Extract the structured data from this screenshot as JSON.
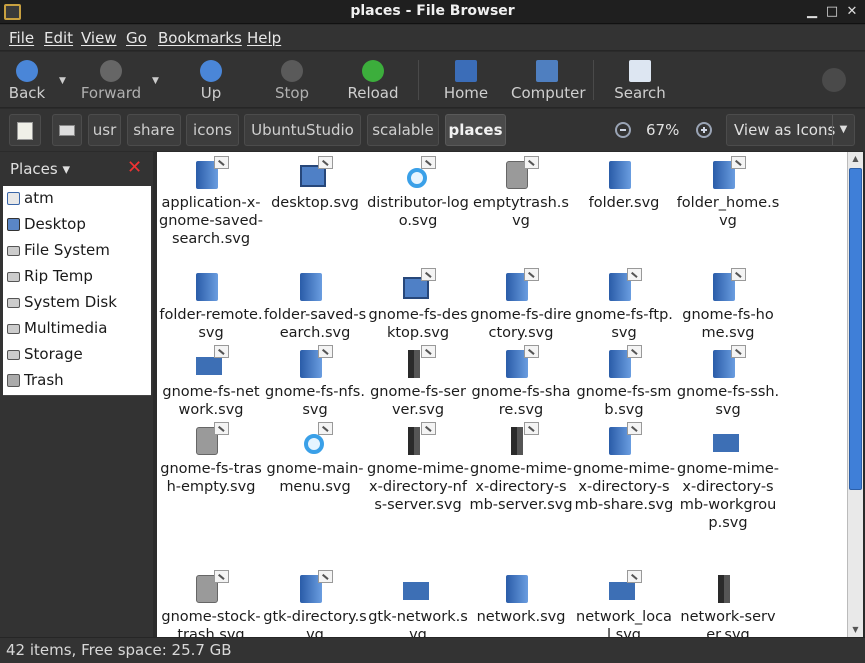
{
  "window": {
    "title": "places - File Browser"
  },
  "menubar": {
    "items": [
      "File",
      "Edit",
      "View",
      "Go",
      "Bookmarks",
      "Help"
    ]
  },
  "toolbar": {
    "buttons": [
      {
        "label": "Back",
        "icon": "back-arrow-icon"
      },
      {
        "label": "Forward",
        "icon": "forward-arrow-icon"
      },
      {
        "label": "Up",
        "icon": "up-arrow-icon"
      },
      {
        "label": "Stop",
        "icon": "stop-icon"
      },
      {
        "label": "Reload",
        "icon": "reload-icon"
      },
      {
        "label": "Home",
        "icon": "home-icon"
      },
      {
        "label": "Computer",
        "icon": "computer-icon"
      },
      {
        "label": "Search",
        "icon": "search-icon"
      }
    ]
  },
  "location": {
    "path": [
      "usr",
      "share",
      "icons",
      "UbuntuStudio",
      "scalable",
      "places"
    ],
    "zoom": "67%",
    "view_mode": "View as Icons"
  },
  "sidebar": {
    "title": "Places",
    "items": [
      "atm",
      "Desktop",
      "File System",
      "Rip Temp",
      "System Disk",
      "Multimedia",
      "Storage",
      "Trash"
    ]
  },
  "files": [
    {
      "name": "application-x-gnome-saved-search.svg",
      "icon": "saved-search-folder-icon"
    },
    {
      "name": "desktop.svg",
      "icon": "desktop-icon"
    },
    {
      "name": "distributor-logo.svg",
      "icon": "distributor-logo-icon"
    },
    {
      "name": "emptytrash.svg",
      "icon": "trash-icon"
    },
    {
      "name": "folder.svg",
      "icon": "folder-icon"
    },
    {
      "name": "folder_home.svg",
      "icon": "home-folder-icon"
    },
    {
      "name": "folder-remote.svg",
      "icon": "folder-icon"
    },
    {
      "name": "folder-saved-search.svg",
      "icon": "saved-search-folder-icon"
    },
    {
      "name": "gnome-fs-desktop.svg",
      "icon": "desktop-icon"
    },
    {
      "name": "gnome-fs-directory.svg",
      "icon": "folder-icon"
    },
    {
      "name": "gnome-fs-ftp.svg",
      "icon": "folder-icon"
    },
    {
      "name": "gnome-fs-home.svg",
      "icon": "home-folder-icon"
    },
    {
      "name": "gnome-fs-network.svg",
      "icon": "network-icon"
    },
    {
      "name": "gnome-fs-nfs.svg",
      "icon": "folder-icon"
    },
    {
      "name": "gnome-fs-server.svg",
      "icon": "server-icon"
    },
    {
      "name": "gnome-fs-share.svg",
      "icon": "folder-icon"
    },
    {
      "name": "gnome-fs-smb.svg",
      "icon": "folder-icon"
    },
    {
      "name": "gnome-fs-ssh.svg",
      "icon": "folder-icon"
    },
    {
      "name": "gnome-fs-trash-empty.svg",
      "icon": "trash-icon"
    },
    {
      "name": "gnome-main-menu.svg",
      "icon": "distributor-logo-icon"
    },
    {
      "name": "gnome-mime-x-directory-nfs-server.svg",
      "icon": "server-icon"
    },
    {
      "name": "gnome-mime-x-directory-smb-server.svg",
      "icon": "server-icon"
    },
    {
      "name": "gnome-mime-x-directory-smb-share.svg",
      "icon": "folder-icon"
    },
    {
      "name": "gnome-mime-x-directory-smb-workgroup.svg",
      "icon": "network-icon"
    },
    {
      "name": "gnome-stock-trash.svg",
      "icon": "trash-icon"
    },
    {
      "name": "gtk-directory.svg",
      "icon": "folder-icon"
    },
    {
      "name": "gtk-network.svg",
      "icon": "network-icon"
    },
    {
      "name": "network.svg",
      "icon": "folder-icon"
    },
    {
      "name": "network_local.svg",
      "icon": "network-icon"
    },
    {
      "name": "network-server.svg",
      "icon": "server-icon"
    }
  ],
  "status": {
    "text": "42 items, Free space: 25.7 GB"
  },
  "colors": {
    "accent": "#3f7fd8",
    "chrome": "#333333"
  }
}
